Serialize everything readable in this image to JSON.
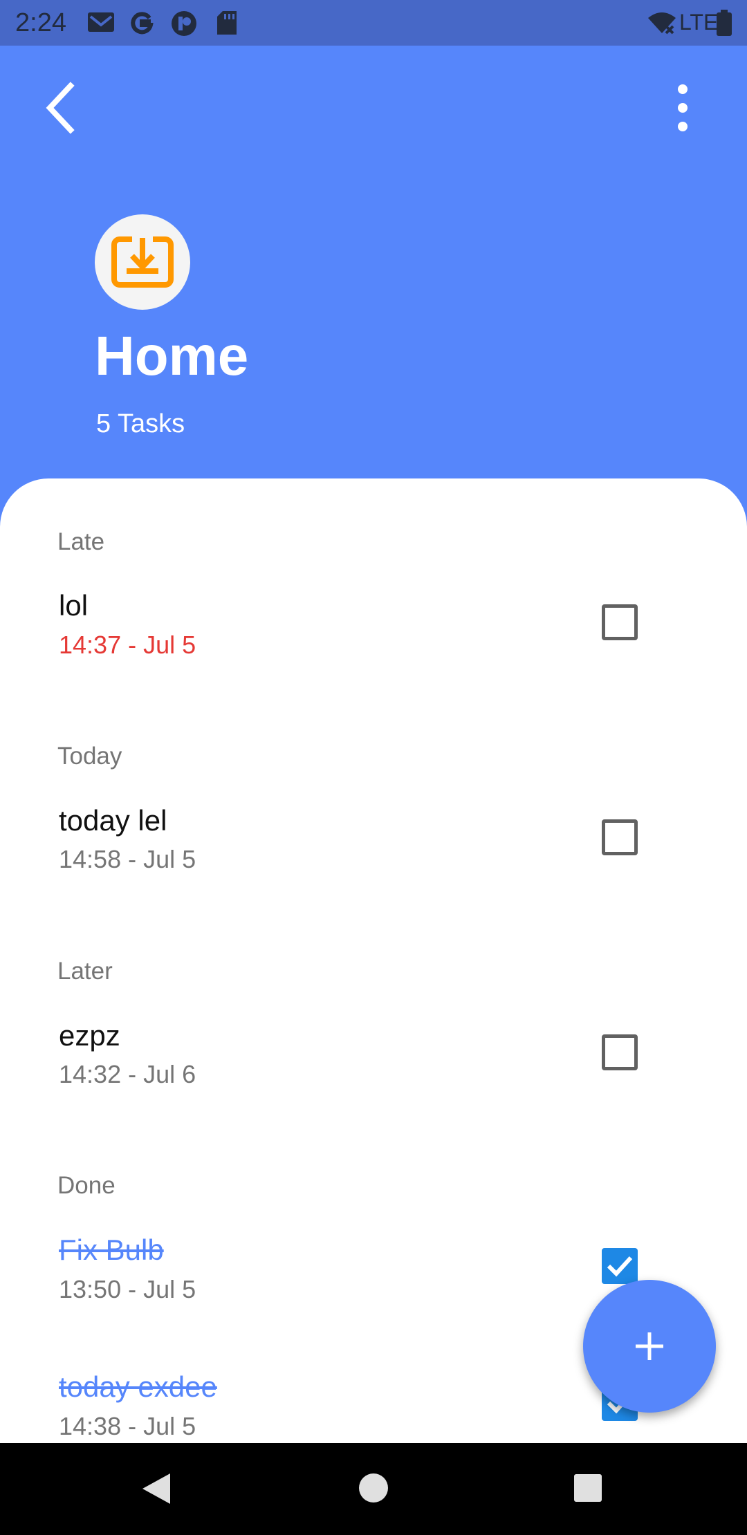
{
  "status_bar": {
    "time": "2:24",
    "icons": [
      "gmail-icon",
      "google-icon",
      "app-icon",
      "sd-card-icon",
      "wifi-off-icon",
      "lte-icon",
      "battery-icon"
    ],
    "network": "LTE"
  },
  "app_bar": {
    "back_icon": "chevron-left-icon",
    "menu_icon": "more-vert-icon"
  },
  "header": {
    "icon": "inbox-download-icon",
    "icon_color": "#ff9800",
    "title": "Home",
    "subtitle": "5 Tasks",
    "background_color": "#5686fb"
  },
  "sections": [
    {
      "label": "Late",
      "tasks": [
        {
          "title": "lol",
          "time": "14:37 - Jul 5",
          "checked": false,
          "late": true
        }
      ]
    },
    {
      "label": "Today",
      "tasks": [
        {
          "title": "today lel",
          "time": "14:58 - Jul 5",
          "checked": false
        }
      ]
    },
    {
      "label": "Later",
      "tasks": [
        {
          "title": "ezpz",
          "time": "14:32 - Jul 6",
          "checked": false
        }
      ]
    },
    {
      "label": "Done",
      "tasks": [
        {
          "title": "Fix Bulb",
          "time": "13:50 - Jul 5",
          "checked": true
        },
        {
          "title": "today exdee",
          "time": "14:38 - Jul 5",
          "checked": true
        }
      ]
    }
  ],
  "fab": {
    "icon": "plus-icon"
  },
  "nav_bar": {
    "icons": [
      "back-triangle-icon",
      "home-circle-icon",
      "recents-square-icon"
    ]
  }
}
